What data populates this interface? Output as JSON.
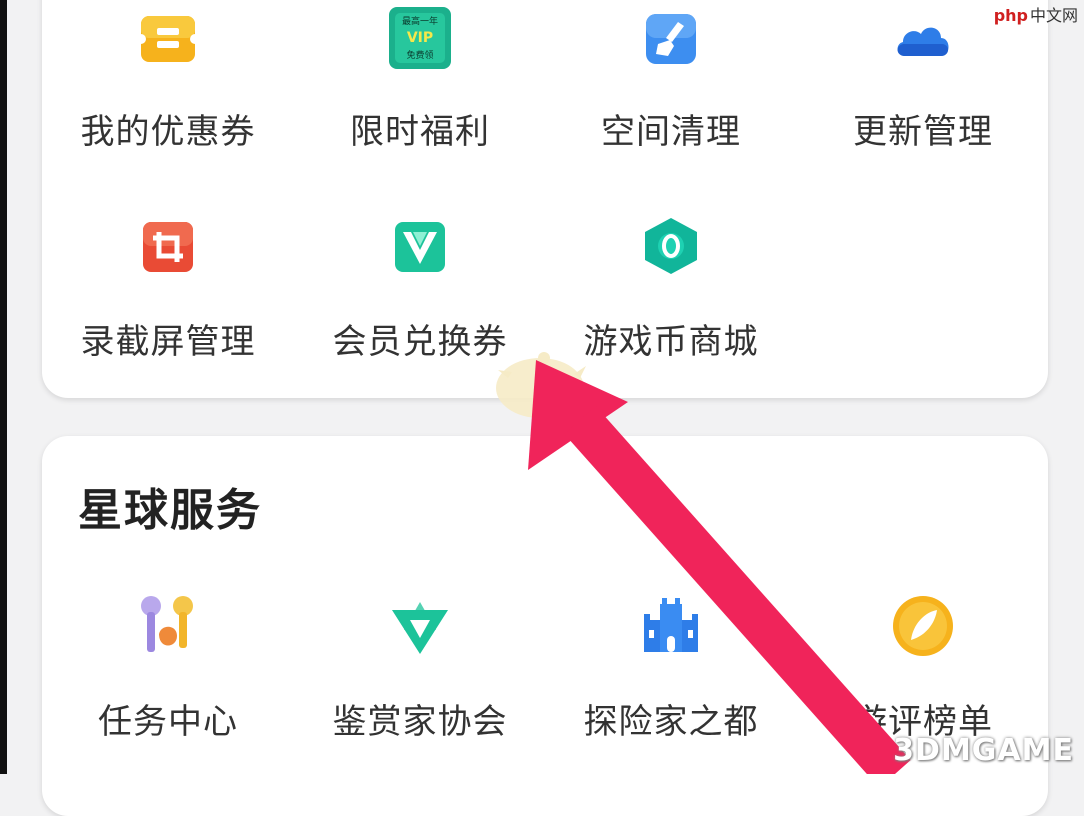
{
  "colors": {
    "page_bg": "#f2f2f3",
    "card_bg": "#ffffff",
    "text": "#333333",
    "arrow": "#f0245a"
  },
  "top_grid": {
    "items": [
      {
        "label": "我的优惠券",
        "icon": "coupon-icon"
      },
      {
        "label": "限时福利",
        "icon": "vip-welfare-icon",
        "icon_text": [
          "最高一年",
          "VIP",
          "免费领"
        ]
      },
      {
        "label": "空间清理",
        "icon": "broom-clean-icon"
      },
      {
        "label": "更新管理",
        "icon": "cloud-update-icon"
      },
      {
        "label": "录截屏管理",
        "icon": "crop-screenshot-icon"
      },
      {
        "label": "会员兑换券",
        "icon": "v-member-icon"
      },
      {
        "label": "游戏币商城",
        "icon": "coin-hexagon-icon"
      }
    ]
  },
  "planet_services": {
    "title": "星球服务",
    "items": [
      {
        "label": "任务中心",
        "icon": "task-keys-icon"
      },
      {
        "label": "鉴赏家协会",
        "icon": "star-triangle-icon"
      },
      {
        "label": "探险家之都",
        "icon": "castle-icon"
      },
      {
        "label": "游评榜单",
        "icon": "quill-badge-icon"
      }
    ]
  },
  "watermarks": {
    "top_brand": "php",
    "top_cn": "中文网",
    "bottom": "3DMGAME"
  }
}
